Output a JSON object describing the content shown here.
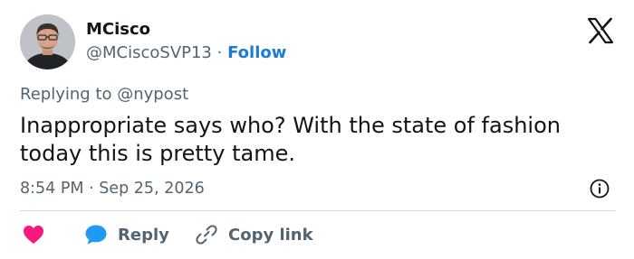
{
  "user": {
    "name": "MCisco",
    "handle": "@MCiscoSVP13",
    "separator": "·",
    "follow_label": "Follow"
  },
  "tweet": {
    "replying_to": "Replying to @nypost",
    "text": "Inappropriate says who? With the state of fashion today this is pretty tame.",
    "time": "8:54 PM",
    "date_separator": "·",
    "date": "Sep 25, 2026"
  },
  "actions": {
    "reply_label": "Reply",
    "copy_link_label": "Copy link"
  },
  "icons": {
    "like": "heart-icon",
    "reply": "speech-bubble-icon",
    "copy_link": "link-icon",
    "info": "info-icon",
    "logo": "x-logo-icon"
  },
  "colors": {
    "follow": "#1d7bd4",
    "like": "#f91880",
    "reply": "#1d9bf0",
    "secondary_text": "#536471"
  }
}
